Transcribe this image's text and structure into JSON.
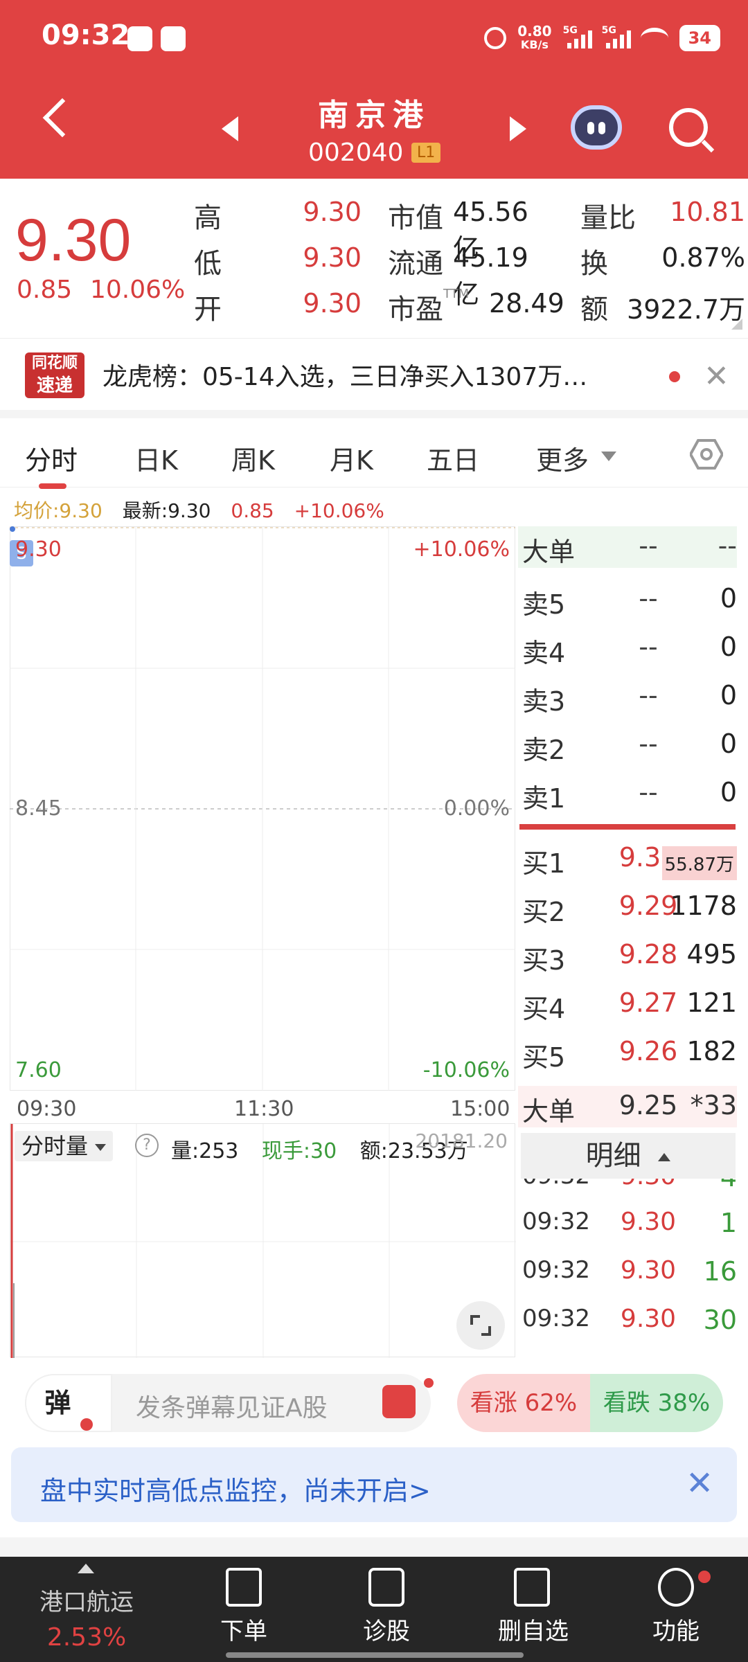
{
  "status_bar": {
    "time": "09:32",
    "net_speed_value": "0.80",
    "net_speed_unit": "KB/s",
    "sig1": "5G",
    "sig2": "5G",
    "battery": "34"
  },
  "header": {
    "stock_name": "南京港",
    "stock_code": "002040",
    "level": "L1"
  },
  "quote": {
    "price": "9.30",
    "change": "0.85",
    "change_pct": "10.06%",
    "rows": [
      {
        "l1": "高",
        "v1": "9.30",
        "l2": "市值",
        "v2": "45.56亿",
        "l3": "量比",
        "v3": "10.81"
      },
      {
        "l1": "低",
        "v1": "9.30",
        "l2": "流通",
        "v2": "45.19亿",
        "l3": "换",
        "v3": "0.87%"
      },
      {
        "l1": "开",
        "v1": "9.30",
        "l2": "市盈",
        "l2_sup": "TTM",
        "v2": "28.49",
        "l3": "额",
        "v3": "3922.7万"
      }
    ]
  },
  "news": {
    "logo_line1": "同花顺",
    "logo_line2": "速递",
    "text": "龙虎榜：05-14入选，三日净买入1307万…"
  },
  "tabs": [
    "分时",
    "日K",
    "周K",
    "月K",
    "五日",
    "更多"
  ],
  "info_line": {
    "avg": "均价:9.30",
    "latest": "最新:9.30",
    "change": "0.85",
    "pct": "+10.06%"
  },
  "chart": {
    "top_left": "9.30",
    "top_right": "+10.06%",
    "mid_left": "8.45",
    "mid_right": "0.00%",
    "bottom_left": "7.60",
    "bottom_right": "-10.06%",
    "t_start": "09:30",
    "t_mid": "11:30",
    "t_end": "15:00",
    "badge": "S"
  },
  "volume": {
    "selector": "分时量",
    "help": "?",
    "vol": "量:253",
    "now": "现手:30",
    "amt": "额:23.53万",
    "max_label": "20181.20"
  },
  "book": {
    "big_top_label": "大单",
    "big_top_p": "--",
    "big_top_v": "--",
    "asks": [
      {
        "l": "卖5",
        "p": "--",
        "v": "0"
      },
      {
        "l": "卖4",
        "p": "--",
        "v": "0"
      },
      {
        "l": "卖3",
        "p": "--",
        "v": "0"
      },
      {
        "l": "卖2",
        "p": "--",
        "v": "0"
      },
      {
        "l": "卖1",
        "p": "--",
        "v": "0"
      }
    ],
    "bids": [
      {
        "l": "买1",
        "p": "9.30",
        "v": "55.87万"
      },
      {
        "l": "买2",
        "p": "9.29",
        "v": "1178"
      },
      {
        "l": "买3",
        "p": "9.28",
        "v": "495"
      },
      {
        "l": "买4",
        "p": "9.27",
        "v": "121"
      },
      {
        "l": "买5",
        "p": "9.26",
        "v": "182"
      }
    ],
    "big_bottom_label": "大单",
    "big_bottom_p": "9.25",
    "big_bottom_v": "*33"
  },
  "detail": {
    "title": "明细",
    "rows": [
      {
        "t": "09:32",
        "p": "9.30",
        "v": "4"
      },
      {
        "t": "09:32",
        "p": "9.30",
        "v": "1"
      },
      {
        "t": "09:32",
        "p": "9.30",
        "v": "16"
      },
      {
        "t": "09:32",
        "p": "9.30",
        "v": "30"
      }
    ]
  },
  "danmu": {
    "label": "弹",
    "placeholder": "发条弹幕见证A股"
  },
  "vote": {
    "up": "看涨 62%",
    "down": "看跌 38%"
  },
  "monitor": {
    "text": "盘中实时高低点监控，尚未开启>"
  },
  "bottom_bar": {
    "sector_name": "港口航运",
    "sector_pct": "2.53%",
    "items": [
      "下单",
      "诊股",
      "删自选",
      "功能"
    ]
  },
  "colors": {
    "header_red": "#e04242",
    "up_red": "#d63c3c",
    "down_green": "#3a9a3a"
  }
}
